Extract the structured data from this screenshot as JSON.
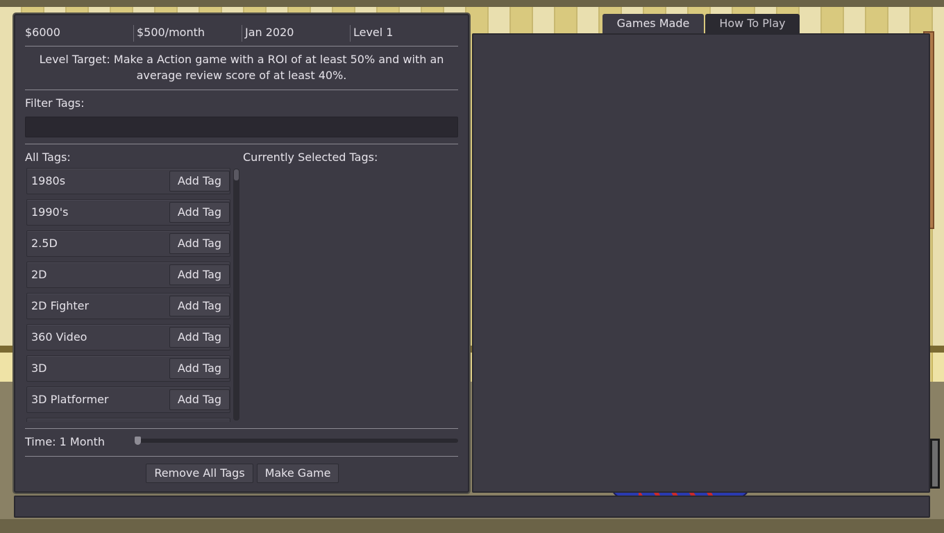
{
  "stats": {
    "money": "$6000",
    "expense": "$500/month",
    "date": "Jan 2020",
    "level": "Level 1"
  },
  "level_target": "Level Target: Make a Action game with a ROI of at least 50% and with an average review score of at least 40%.",
  "filter": {
    "label": "Filter Tags:",
    "value": ""
  },
  "all_tags": {
    "label": "All Tags:",
    "add_label": "Add Tag",
    "items": [
      "1980s",
      "1990's",
      "2.5D",
      "2D",
      "2D Fighter",
      "360 Video",
      "3D",
      "3D Platformer"
    ]
  },
  "selected_tags": {
    "label": "Currently Selected Tags:",
    "items": []
  },
  "time": {
    "label": "Time: 1 Month",
    "slider_fraction": 0
  },
  "buttons": {
    "remove_all": "Remove All Tags",
    "make_game": "Make Game"
  },
  "tabs": {
    "games_made": "Games Made",
    "how_to_play": "How To Play"
  }
}
